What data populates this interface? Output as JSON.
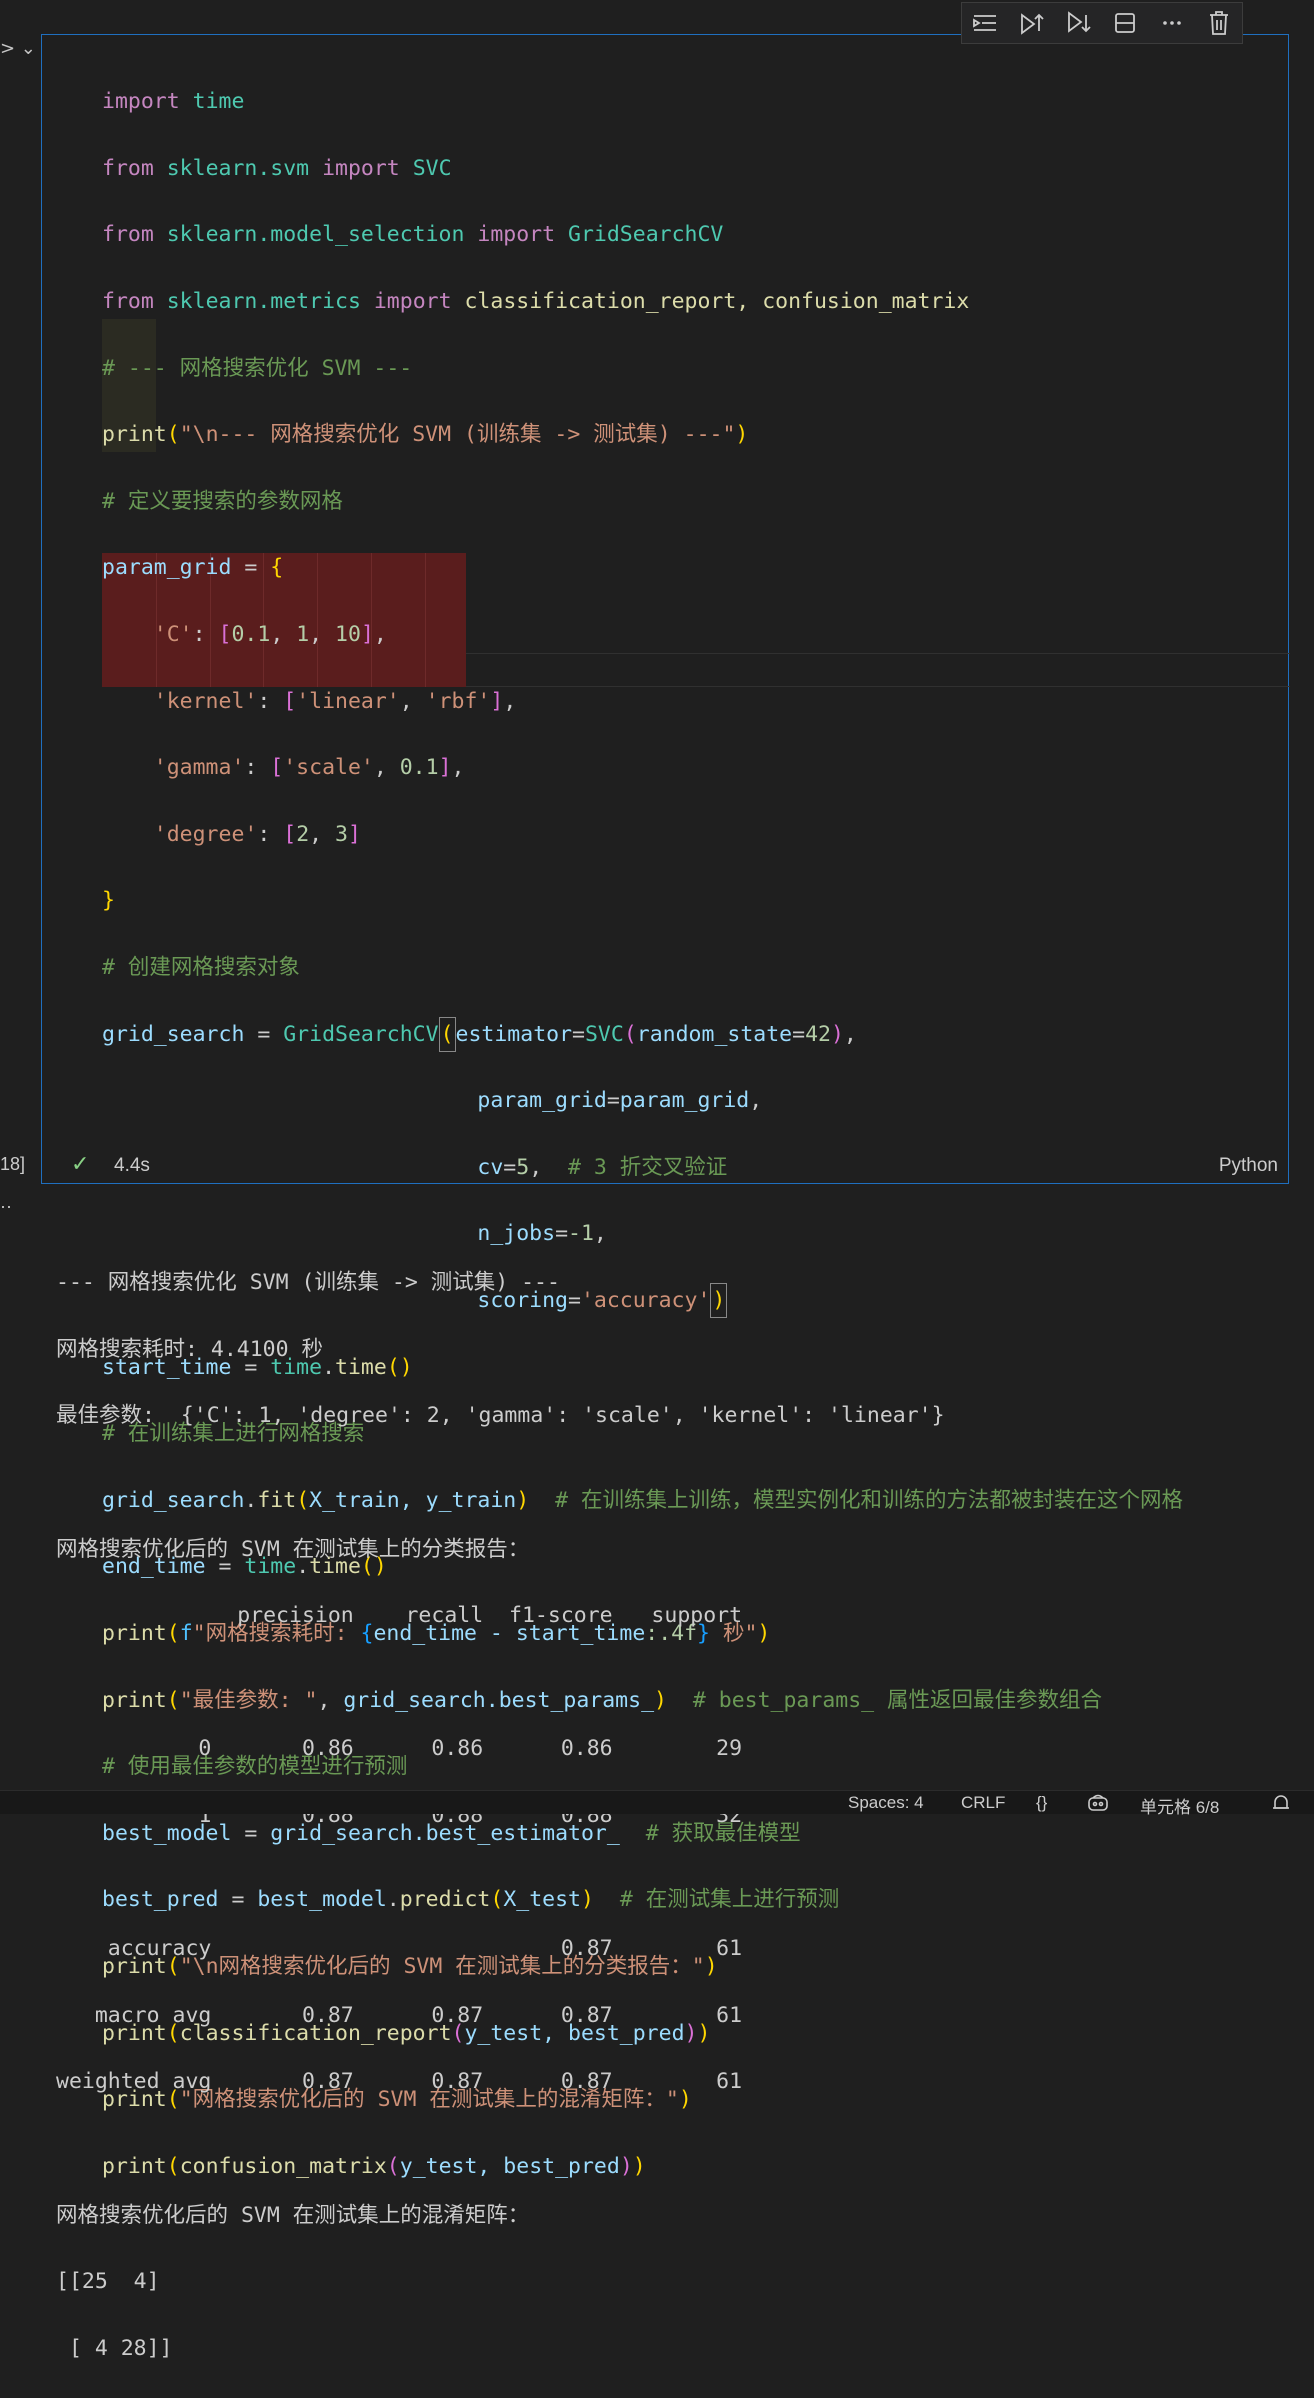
{
  "toolbar": {
    "icons": [
      "run-by-line-icon",
      "execute-above-icon",
      "execute-below-icon",
      "split-cell-icon",
      "more-icon",
      "delete-icon"
    ]
  },
  "cell": {
    "exec_label": "18]",
    "status_time": "4.4s",
    "language": "Python"
  },
  "code": {
    "l1_kw": "import",
    "l1_mod": "time",
    "l2_kw": "from",
    "l2_mod": "sklearn.svm",
    "l2_kw2": "import",
    "l2_cls": "SVC",
    "l3_kw": "from",
    "l3_mod": "sklearn.model_selection",
    "l3_kw2": "import",
    "l3_cls": "GridSearchCV",
    "l4_kw": "from",
    "l4_mod": "sklearn.metrics",
    "l4_kw2": "import",
    "l4_names": "classification_report, confusion_matrix",
    "l5": "# --- 网格搜索优化 SVM ---",
    "l6_fn": "print",
    "l6_str": "\"\\n--- 网格搜索优化 SVM (训练集 -> 测试集) ---\"",
    "l7": "# 定义要搜索的参数网格",
    "l8_var": "param_grid",
    "l9_key": "'C'",
    "l9_vals": [
      "0.1",
      "1",
      "10"
    ],
    "l10_key": "'kernel'",
    "l10_vals": [
      "'linear'",
      "'rbf'"
    ],
    "l11_key": "'gamma'",
    "l11_v1": "'scale'",
    "l11_v2": "0.1",
    "l12_key": "'degree'",
    "l12_vals": [
      "2",
      "3"
    ],
    "l14": "# 创建网格搜索对象",
    "l15_var": "grid_search",
    "l15_cls": "GridSearchCV",
    "l15_arg": "estimator",
    "l15_cls2": "SVC",
    "l15_arg2": "random_state",
    "l15_num": "42",
    "l16_arg": "param_grid",
    "l16_val": "param_grid",
    "l17_arg": "cv",
    "l17_num": "5",
    "l17_cmt": "# 3 折交叉验证",
    "l18_arg": "n_jobs",
    "l18_num": "-1",
    "l19_arg": "scoring",
    "l19_str": "'accuracy'",
    "l20_var": "start_time",
    "l20_mod": "time",
    "l20_fn": "time",
    "l21": "# 在训练集上进行网格搜索",
    "l22_var": "grid_search",
    "l22_fn": "fit",
    "l22_args": "X_train, y_train",
    "l22_cmt": "# 在训练集上训练，模型实例化和训练的方法都被封装在这个网格",
    "l23_var": "end_time",
    "l23_mod": "time",
    "l23_fn": "time",
    "l24_fn": "print",
    "l24_f": "f",
    "l24_s1": "\"网格搜索耗时: ",
    "l24_expr": "end_time - start_time",
    "l24_fmt": ":.4f",
    "l24_s2": " 秒\"",
    "l25_fn": "print",
    "l25_str": "\"最佳参数: \"",
    "l25_var": "grid_search.best_params_",
    "l25_cmt": "# best_params_ 属性返回最佳参数组合",
    "l26": "# 使用最佳参数的模型进行预测",
    "l27_var": "best_model",
    "l27_val": "grid_search.best_estimator_",
    "l27_cmt": "# 获取最佳模型",
    "l28_var": "best_pred",
    "l28_obj": "best_model",
    "l28_fn": "predict",
    "l28_arg": "X_test",
    "l28_cmt": "# 在测试集上进行预测",
    "l29_fn": "print",
    "l29_str": "\"\\n网格搜索优化后的 SVM 在测试集上的分类报告：\"",
    "l30_fn": "print",
    "l30_fn2": "classification_report",
    "l30_args": "y_test, best_pred",
    "l31_fn": "print",
    "l31_str": "\"网格搜索优化后的 SVM 在测试集上的混淆矩阵：\"",
    "l32_fn": "print",
    "l32_fn2": "confusion_matrix",
    "l32_args": "y_test, best_pred"
  },
  "output": {
    "lines": [
      "--- 网格搜索优化 SVM (训练集 -> 测试集) ---",
      "网格搜索耗时: 4.4100 秒",
      "最佳参数:  {'C': 1, 'degree': 2, 'gamma': 'scale', 'kernel': 'linear'}",
      "",
      "网格搜索优化后的 SVM 在测试集上的分类报告：",
      "              precision    recall  f1-score   support",
      "",
      "           0       0.86      0.86      0.86        29",
      "           1       0.88      0.88      0.88        32",
      "",
      "    accuracy                           0.87        61",
      "   macro avg       0.87      0.87      0.87        61",
      "weighted avg       0.87      0.87      0.87        61",
      "",
      "网格搜索优化后的 SVM 在测试集上的混淆矩阵：",
      "[[25  4]",
      " [ 4 28]]"
    ]
  },
  "statusbar": {
    "spaces": "Spaces: 4",
    "eol": "CRLF",
    "braces": "{}",
    "cell_pos": "单元格 6/8"
  }
}
